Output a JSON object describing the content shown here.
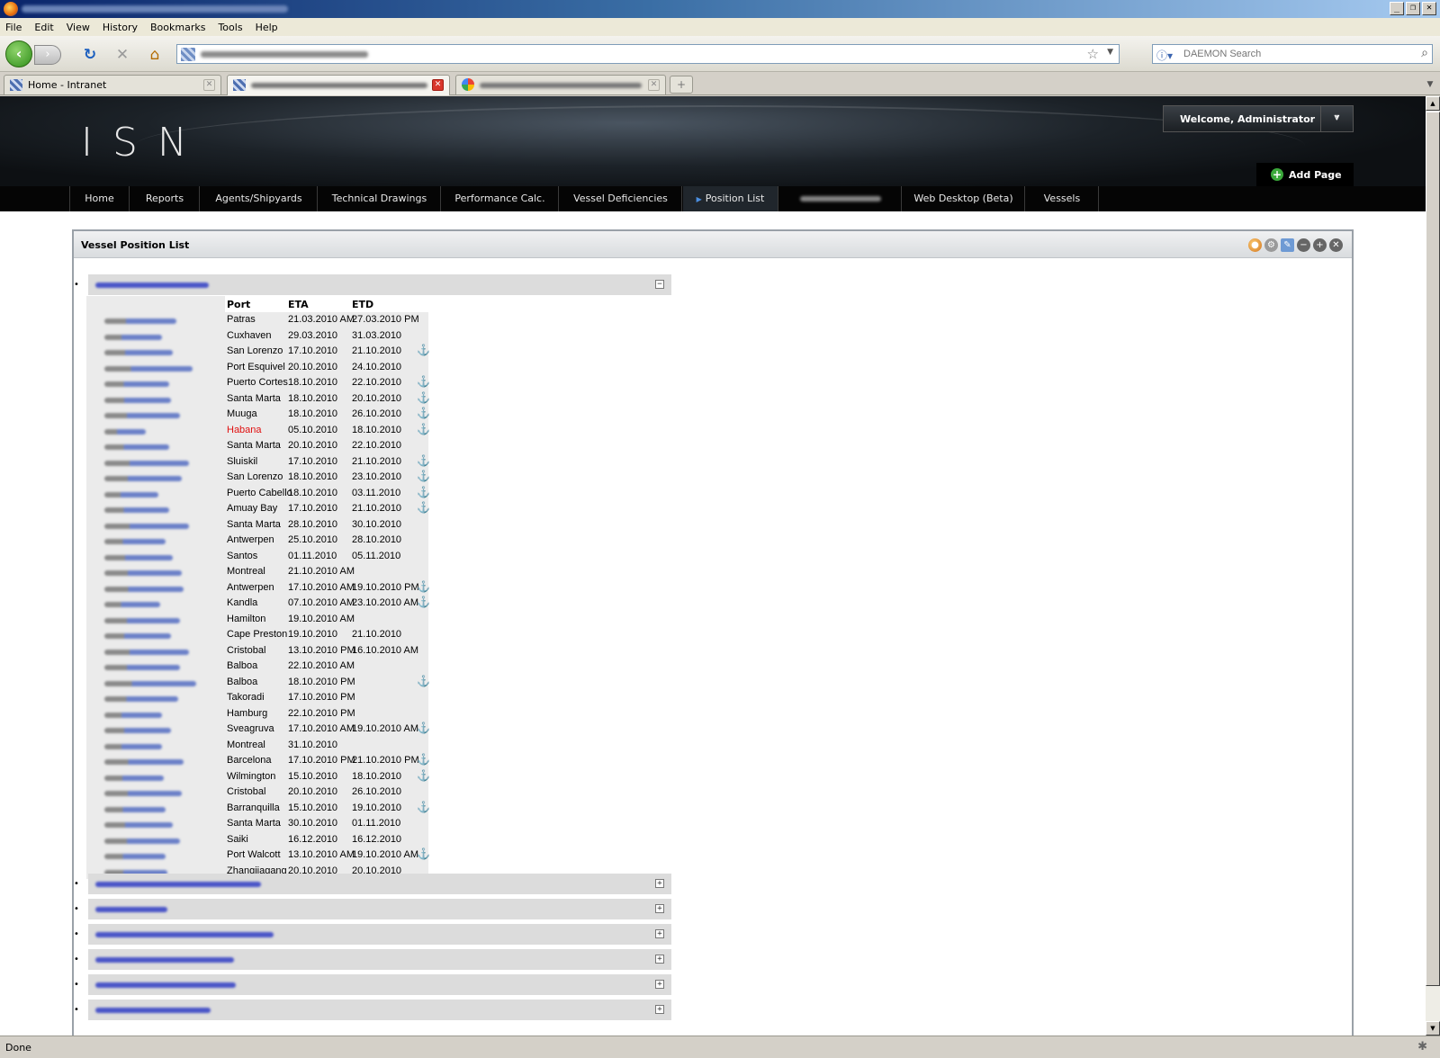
{
  "browser": {
    "menu": [
      "File",
      "Edit",
      "View",
      "History",
      "Bookmarks",
      "Tools",
      "Help"
    ],
    "search_placeholder": "DAEMON Search",
    "tabs": [
      {
        "label": "Home - Intranet"
      }
    ],
    "status": "Done"
  },
  "site": {
    "logo": "ISN",
    "welcome": "Welcome, Administrator",
    "add_page": "Add Page",
    "nav": [
      "Home",
      "Reports",
      "Agents/Shipyards",
      "Technical Drawings",
      "Performance Calc.",
      "Vessel Deficiencies",
      "Position List",
      "Web Desktop (Beta)",
      "Vessels"
    ]
  },
  "portlet": {
    "title": "Vessel Position List",
    "columns": {
      "port": "Port",
      "eta": "ETA",
      "etd": "ETD"
    },
    "rows": [
      {
        "port": "Patras",
        "eta": "21.03.2010 AM",
        "etd": "27.03.2010 PM",
        "anchor": false
      },
      {
        "port": "Cuxhaven",
        "eta": "29.03.2010",
        "etd": "31.03.2010",
        "anchor": false
      },
      {
        "port": "San Lorenzo",
        "eta": "17.10.2010",
        "etd": "21.10.2010",
        "anchor": true
      },
      {
        "port": "Port Esquivel",
        "eta": "20.10.2010",
        "etd": "24.10.2010",
        "anchor": false
      },
      {
        "port": "Puerto Cortes",
        "eta": "18.10.2010",
        "etd": "22.10.2010",
        "anchor": true
      },
      {
        "port": "Santa Marta",
        "eta": "18.10.2010",
        "etd": "20.10.2010",
        "anchor": true
      },
      {
        "port": "Muuga",
        "eta": "18.10.2010",
        "etd": "26.10.2010",
        "anchor": true
      },
      {
        "port": "Habana",
        "eta": "05.10.2010",
        "etd": "18.10.2010",
        "anchor": true,
        "highlight": true
      },
      {
        "port": "Santa Marta",
        "eta": "20.10.2010",
        "etd": "22.10.2010",
        "anchor": false
      },
      {
        "port": "Sluiskil",
        "eta": "17.10.2010",
        "etd": "21.10.2010",
        "anchor": true
      },
      {
        "port": "San Lorenzo",
        "eta": "18.10.2010",
        "etd": "23.10.2010",
        "anchor": true
      },
      {
        "port": "Puerto Cabello",
        "eta": "18.10.2010",
        "etd": "03.11.2010",
        "anchor": true
      },
      {
        "port": "Amuay Bay",
        "eta": "17.10.2010",
        "etd": "21.10.2010",
        "anchor": true
      },
      {
        "port": "Santa Marta",
        "eta": "28.10.2010",
        "etd": "30.10.2010",
        "anchor": false
      },
      {
        "port": "Antwerpen",
        "eta": "25.10.2010",
        "etd": "28.10.2010",
        "anchor": false
      },
      {
        "port": "Santos",
        "eta": "01.11.2010",
        "etd": "05.11.2010",
        "anchor": false
      },
      {
        "port": "Montreal",
        "eta": "21.10.2010 AM",
        "etd": "",
        "anchor": false
      },
      {
        "port": "Antwerpen",
        "eta": "17.10.2010 AM",
        "etd": "19.10.2010 PM",
        "anchor": true
      },
      {
        "port": "Kandla",
        "eta": "07.10.2010 AM",
        "etd": "23.10.2010 AM",
        "anchor": true
      },
      {
        "port": "Hamilton",
        "eta": "19.10.2010 AM",
        "etd": "",
        "anchor": false
      },
      {
        "port": "Cape Preston",
        "eta": "19.10.2010",
        "etd": "21.10.2010",
        "anchor": false
      },
      {
        "port": "Cristobal",
        "eta": "13.10.2010 PM",
        "etd": "16.10.2010 AM",
        "anchor": false
      },
      {
        "port": "Balboa",
        "eta": "22.10.2010 AM",
        "etd": "",
        "anchor": false
      },
      {
        "port": "Balboa",
        "eta": "18.10.2010 PM",
        "etd": "",
        "anchor": true
      },
      {
        "port": "Takoradi",
        "eta": "17.10.2010 PM",
        "etd": "",
        "anchor": false
      },
      {
        "port": "Hamburg",
        "eta": "22.10.2010 PM",
        "etd": "",
        "anchor": false
      },
      {
        "port": "Sveagruva",
        "eta": "17.10.2010 AM",
        "etd": "19.10.2010 AM",
        "anchor": true
      },
      {
        "port": "Montreal",
        "eta": "31.10.2010",
        "etd": "",
        "anchor": false
      },
      {
        "port": "Barcelona",
        "eta": "17.10.2010 PM",
        "etd": "21.10.2010 PM",
        "anchor": true
      },
      {
        "port": "Wilmington",
        "eta": "15.10.2010",
        "etd": "18.10.2010",
        "anchor": true
      },
      {
        "port": "Cristobal",
        "eta": "20.10.2010",
        "etd": "26.10.2010",
        "anchor": false
      },
      {
        "port": "Barranquilla",
        "eta": "15.10.2010",
        "etd": "19.10.2010",
        "anchor": true
      },
      {
        "port": "Santa Marta",
        "eta": "30.10.2010",
        "etd": "01.11.2010",
        "anchor": false
      },
      {
        "port": "Saiki",
        "eta": "16.12.2010",
        "etd": "16.12.2010",
        "anchor": false
      },
      {
        "port": "Port Walcott",
        "eta": "13.10.2010 AM",
        "etd": "19.10.2010 AM",
        "anchor": true
      },
      {
        "port": "Zhangjiagang",
        "eta": "20.10.2010",
        "etd": "20.10.2010",
        "anchor": false
      }
    ],
    "anchor_icon": "anchor-icon",
    "highlight_color": "#e01010"
  }
}
